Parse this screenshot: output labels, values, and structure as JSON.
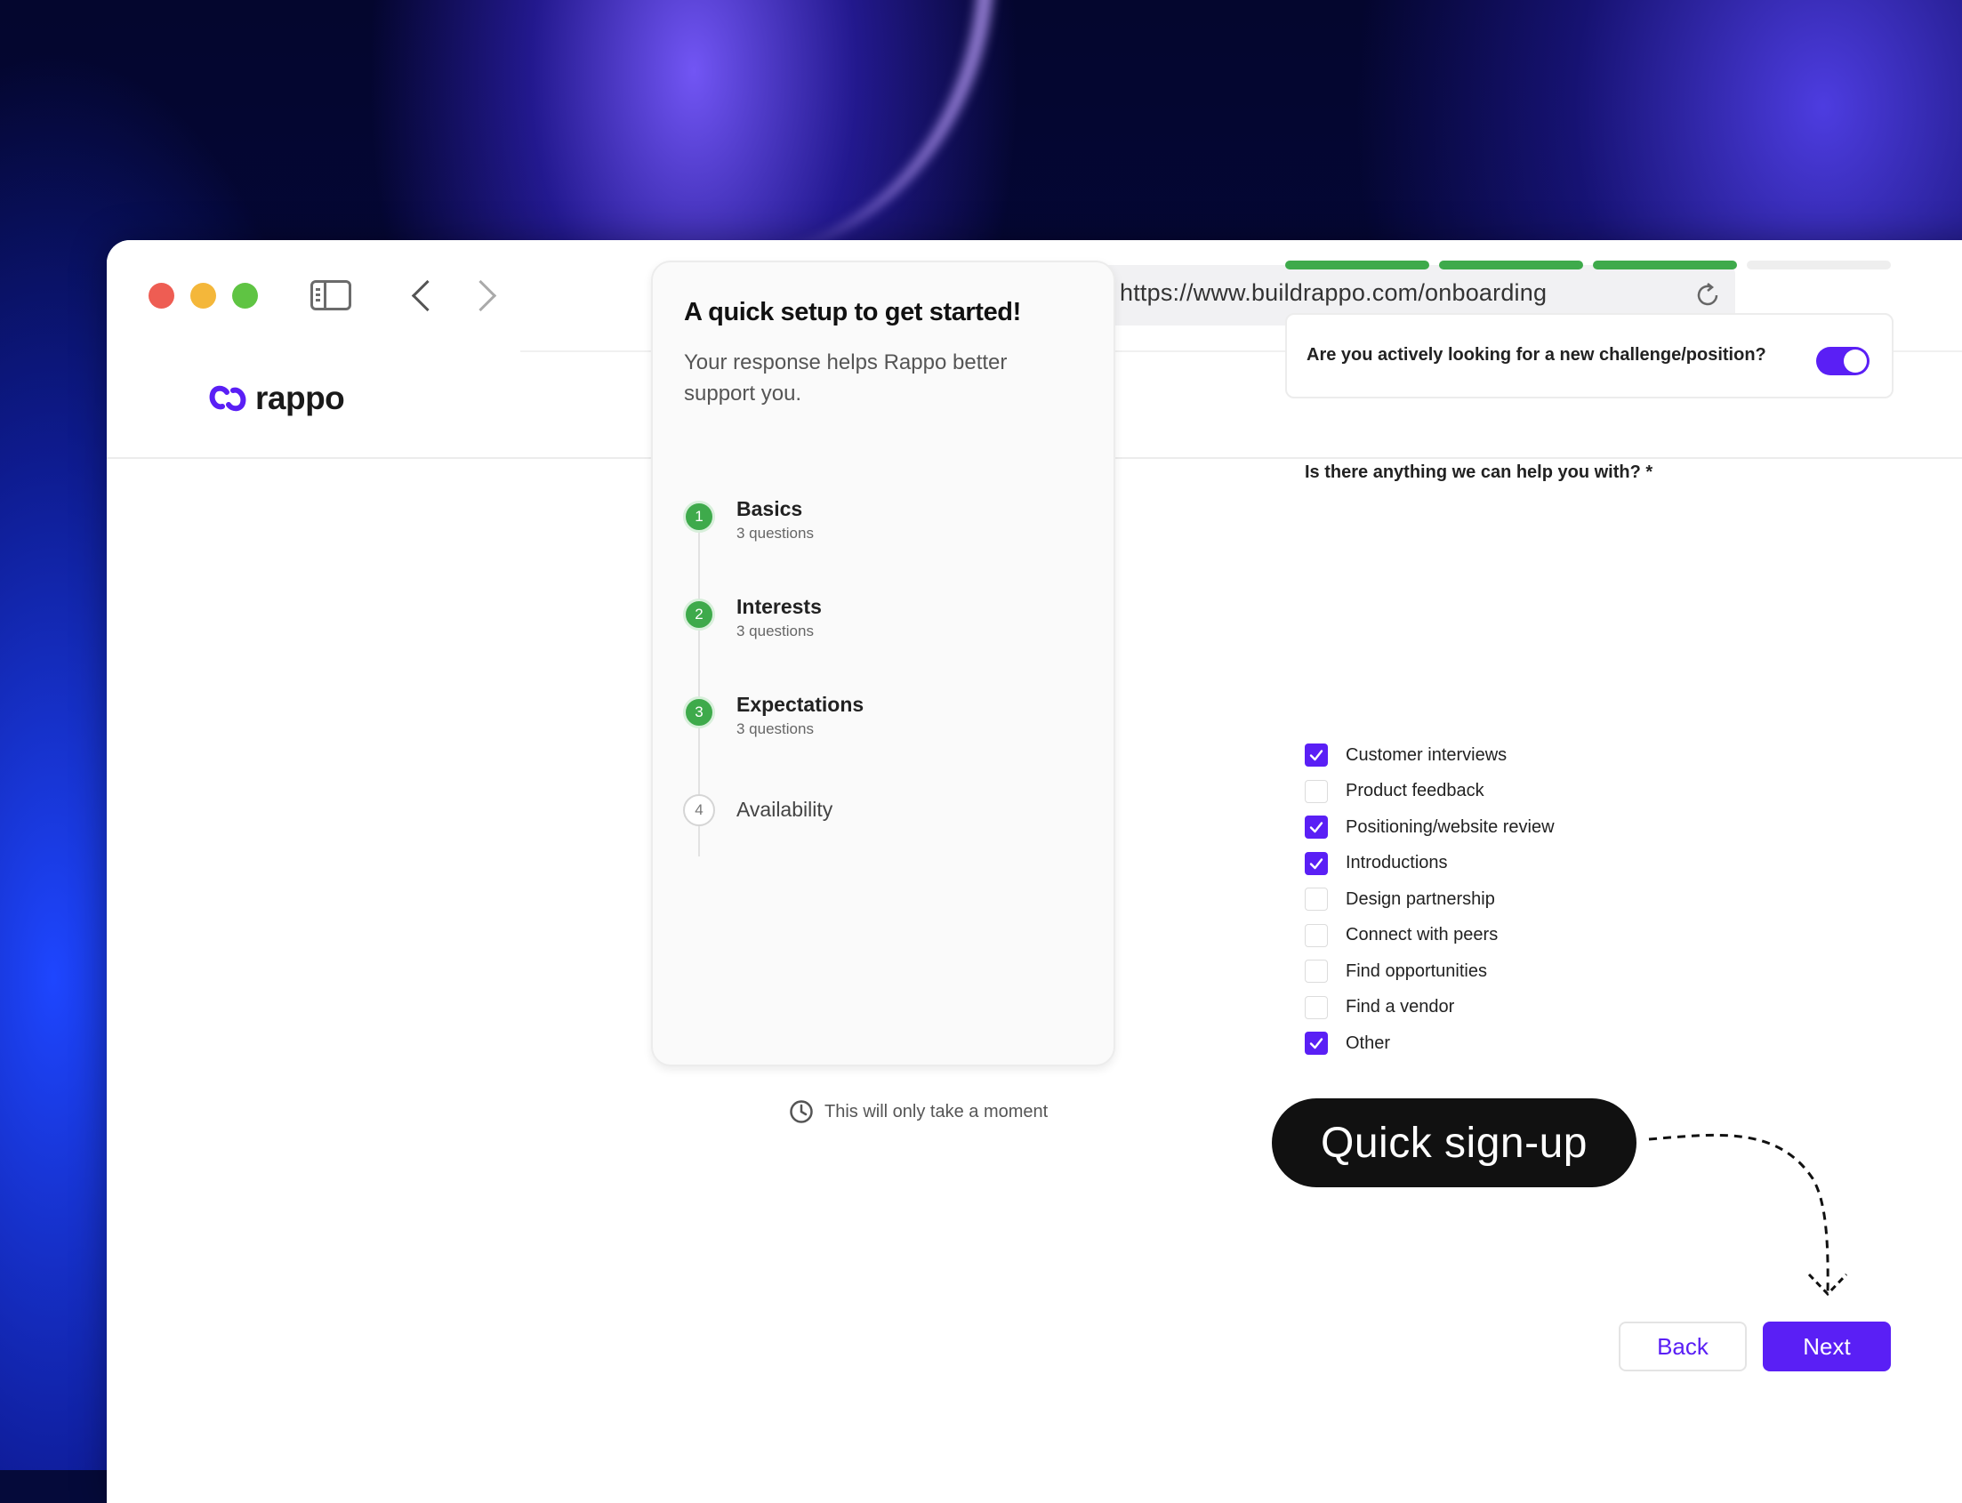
{
  "browser": {
    "url": "https://www.buildrappo.com/onboarding"
  },
  "app": {
    "logo_text": "rappo"
  },
  "setup_card": {
    "title": "A quick setup to get started!",
    "subtitle": "Your response helps Rappo better support you.",
    "steps": [
      {
        "number": "1",
        "label": "Basics",
        "meta": "3 questions",
        "status": "done"
      },
      {
        "number": "2",
        "label": "Interests",
        "meta": "3 questions",
        "status": "done"
      },
      {
        "number": "3",
        "label": "Expectations",
        "meta": "3 questions",
        "status": "done"
      },
      {
        "number": "4",
        "label": "Availability",
        "meta": "",
        "status": "pending"
      }
    ],
    "footer_note": "This will only take a moment"
  },
  "progress": {
    "segments_total": 4,
    "segments_completed": 3,
    "complete_color": "#3eaa4b",
    "pending_color": "#eeeeee"
  },
  "question_toggle": {
    "text": "Are you actively looking for a new challenge/position?",
    "on": true
  },
  "help": {
    "title": "Is there anything we can help you with? *",
    "options": [
      {
        "label": "Customer interviews",
        "checked": true
      },
      {
        "label": "Product feedback",
        "checked": false
      },
      {
        "label": "Positioning/website review",
        "checked": true
      },
      {
        "label": "Introductions",
        "checked": true
      },
      {
        "label": "Design partnership",
        "checked": false
      },
      {
        "label": "Connect with peers",
        "checked": false
      },
      {
        "label": "Find opportunities",
        "checked": false
      },
      {
        "label": "Find a vendor",
        "checked": false
      },
      {
        "label": "Other",
        "checked": true
      }
    ]
  },
  "callout": {
    "text": "Quick sign-up"
  },
  "actions": {
    "back_label": "Back",
    "next_label": "Next"
  },
  "colors": {
    "accent": "#5a1ff5",
    "success": "#3eaa4b"
  }
}
